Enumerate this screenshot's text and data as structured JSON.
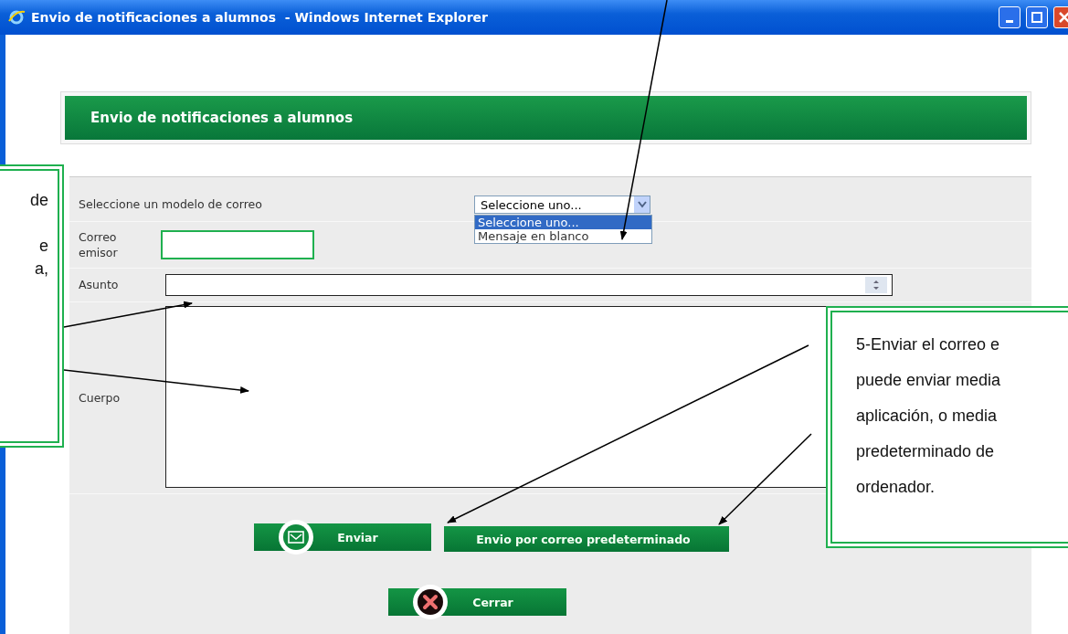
{
  "window": {
    "title": "Envio de notificaciones a alumnos  - Windows Internet Explorer"
  },
  "header": {
    "title": "Envio de notificaciones a alumnos"
  },
  "form": {
    "template": {
      "label": "Seleccione un modelo de correo",
      "value": "Seleccione uno...",
      "options": [
        {
          "label": "Seleccione uno...",
          "selected": true
        },
        {
          "label": "Mensaje en blanco",
          "selected": false
        }
      ]
    },
    "sender": {
      "label_lines": [
        "Correo",
        "emisor"
      ]
    },
    "subject": {
      "label": "Asunto"
    },
    "body": {
      "label": "Cuerpo"
    }
  },
  "buttons": [
    {
      "label": "Enviar",
      "kind": "send"
    },
    {
      "label": "Envio por correo predeterminado",
      "kind": "plain"
    },
    {
      "label": "Cerrar",
      "kind": "close"
    }
  ],
  "callouts": [
    {
      "kind": "left",
      "lines": [
        "de",
        "e",
        "a,"
      ]
    },
    {
      "kind": "right",
      "lines": [
        "5-Enviar el correo e",
        "puede enviar media",
        "aplicación, o media",
        "predeterminado de",
        "ordenador."
      ]
    }
  ]
}
